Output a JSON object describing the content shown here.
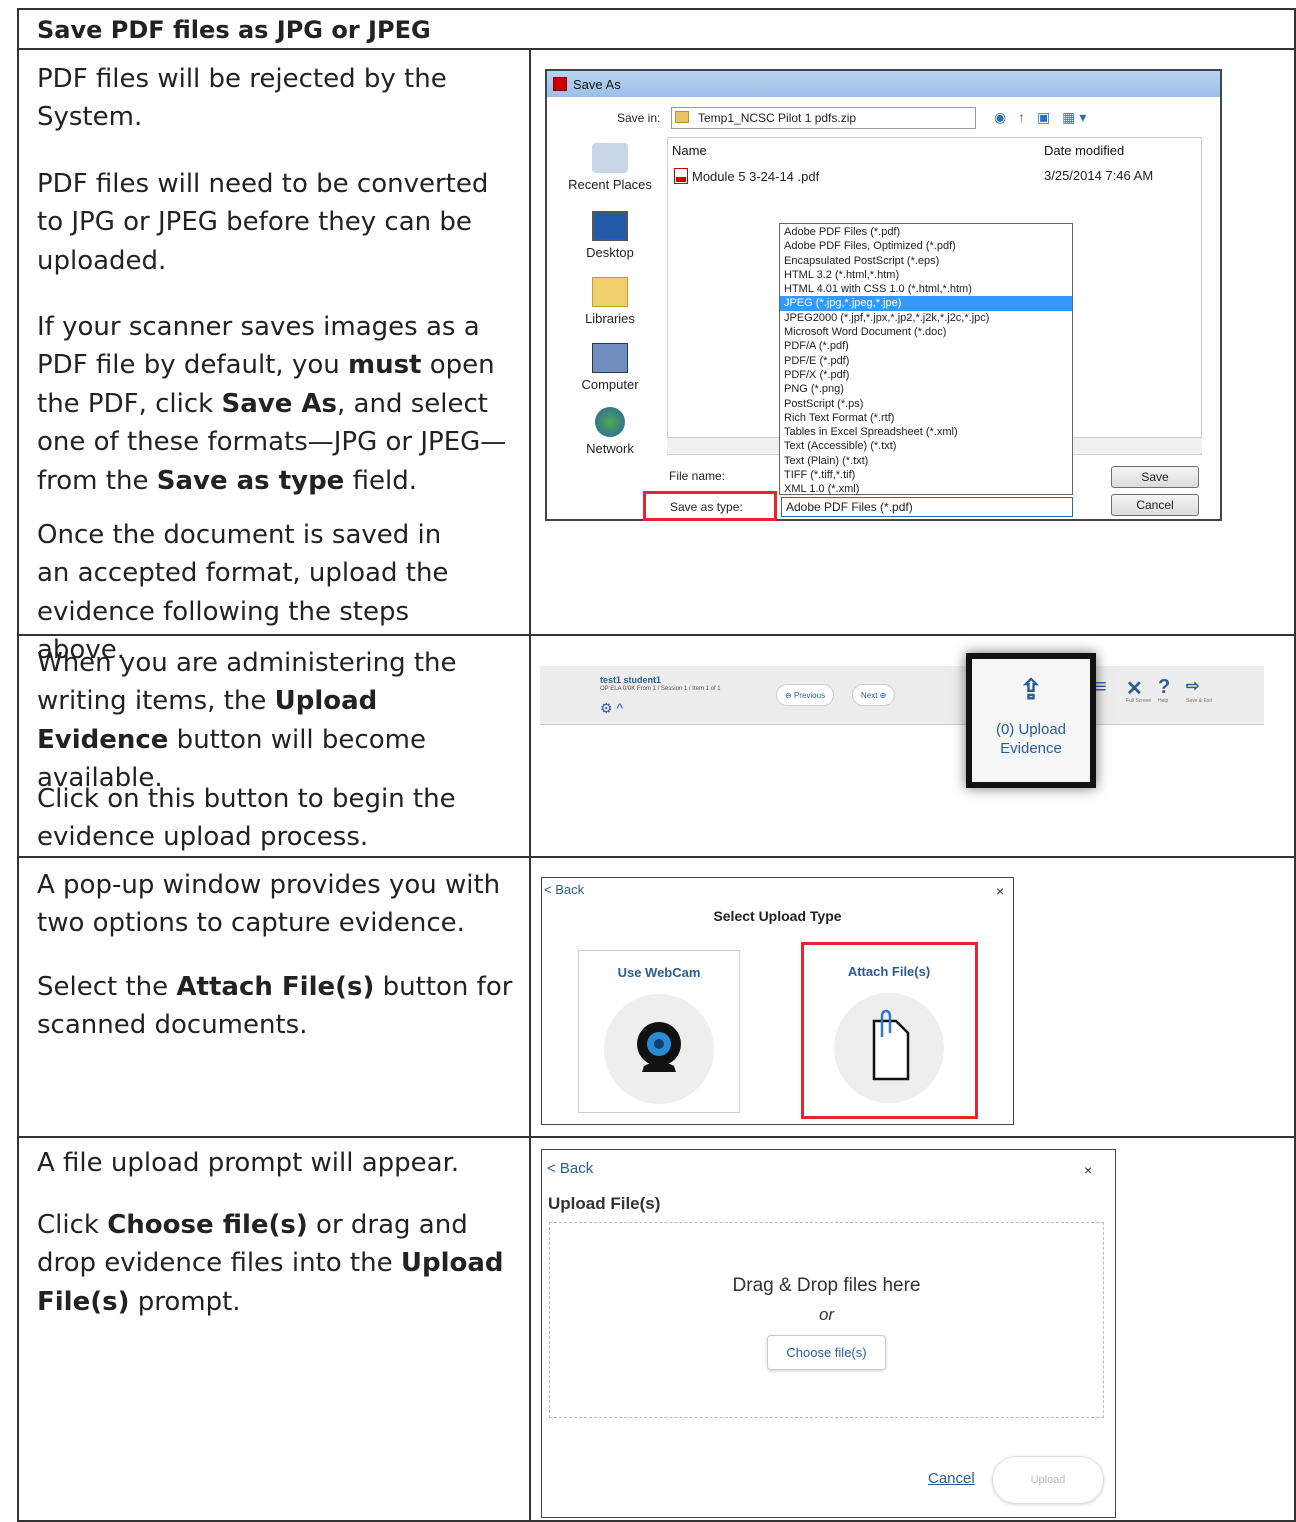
{
  "header": {
    "title": "Save PDF files as JPG or JPEG"
  },
  "section1": {
    "p1": "PDF files will be rejected by the System.",
    "p2": "PDF files will need to be converted to JPG or JPEG before they can be uploaded.",
    "p3_a": "If your scanner saves images as a PDF file by default, you ",
    "p3_b": "must",
    "p3_c": " open the PDF, click ",
    "p3_d": "Save As",
    "p3_e": ", and select one of these formats—JPG or JPEG—from the ",
    "p3_f": "Save as type",
    "p3_g": " field.",
    "p4": "Once the document is saved in an accepted format, upload the evidence following the steps above."
  },
  "save_as_dialog": {
    "title": "Save As",
    "save_in_label": "Save in:",
    "save_in_value": "Temp1_NCSC Pilot 1 pdfs.zip",
    "places": [
      "Recent Places",
      "Desktop",
      "Libraries",
      "Computer",
      "Network"
    ],
    "col_name": "Name",
    "col_date": "Date modified",
    "file_name": "Module 5 3-24-14 .pdf",
    "file_date": "3/25/2014 7:46 AM",
    "file_types": [
      "Adobe PDF Files (*.pdf)",
      "Adobe PDF Files, Optimized (*.pdf)",
      "Encapsulated PostScript (*.eps)",
      "HTML 3.2 (*.html,*.htm)",
      "HTML 4.01 with CSS 1.0 (*.html,*.htm)",
      "JPEG (*.jpg,*.jpeg,*.jpe)",
      "JPEG2000 (*.jpf,*.jpx,*.jp2,*.j2k,*.j2c,*.jpc)",
      "Microsoft Word Document (*.doc)",
      "PDF/A (*.pdf)",
      "PDF/E (*.pdf)",
      "PDF/X (*.pdf)",
      "PNG (*.png)",
      "PostScript (*.ps)",
      "Rich Text Format (*.rtf)",
      "Tables in Excel Spreadsheet (*.xml)",
      "Text (Accessible) (*.txt)",
      "Text (Plain) (*.txt)",
      "TIFF (*.tiff,*.tif)",
      "XML 1.0 (*.xml)"
    ],
    "selected_type_index": 5,
    "file_name_label": "File name:",
    "save_as_type_label": "Save as type:",
    "save_as_type_value": "Adobe PDF Files (*.pdf)",
    "save_button": "Save",
    "cancel_button": "Cancel"
  },
  "section2": {
    "p1_a": "When you are administering the writing items, the ",
    "p1_b": "Upload Evidence",
    "p1_c": " button will become available.",
    "p2": "Click on this button to begin the evidence upload process."
  },
  "toolbar": {
    "student": "test1 student1",
    "subtitle": "OP ELA 0/0K From 1 / Session 1 / Item 1 of 1",
    "previous": "Previous",
    "next": "Next",
    "upload_label": "(0) Upload Evidence",
    "icons": [
      {
        "name": "full-screen-icon",
        "label": "Full Screen"
      },
      {
        "name": "help-icon",
        "label": "Help"
      },
      {
        "name": "save-exit-icon",
        "label": "Save & Exit"
      }
    ]
  },
  "section3": {
    "p1": "A pop-up window provides you with two options to capture evidence.",
    "p2_a": "Select the ",
    "p2_b": "Attach File(s)",
    "p2_c": " button for scanned documents."
  },
  "select_upload": {
    "back": "< Back",
    "close": "×",
    "title": "Select Upload Type",
    "webcam": "Use WebCam",
    "attach": "Attach File(s)"
  },
  "section4": {
    "p1": "A file upload prompt will appear.",
    "p2_a": "Click ",
    "p2_b": "Choose file(s)",
    "p2_c": " or drag and drop evidence files into the ",
    "p2_d": "Upload File(s)",
    "p2_e": " prompt."
  },
  "upload_prompt": {
    "back": "< Back",
    "close": "×",
    "title": "Upload File(s)",
    "drag_text": "Drag & Drop files here",
    "or": "or",
    "choose": "Choose file(s)",
    "cancel": "Cancel",
    "upload": "Upload"
  },
  "colors": {
    "accent": "#2a5d96",
    "highlight": "#e0282c",
    "selection": "#3399ff"
  }
}
